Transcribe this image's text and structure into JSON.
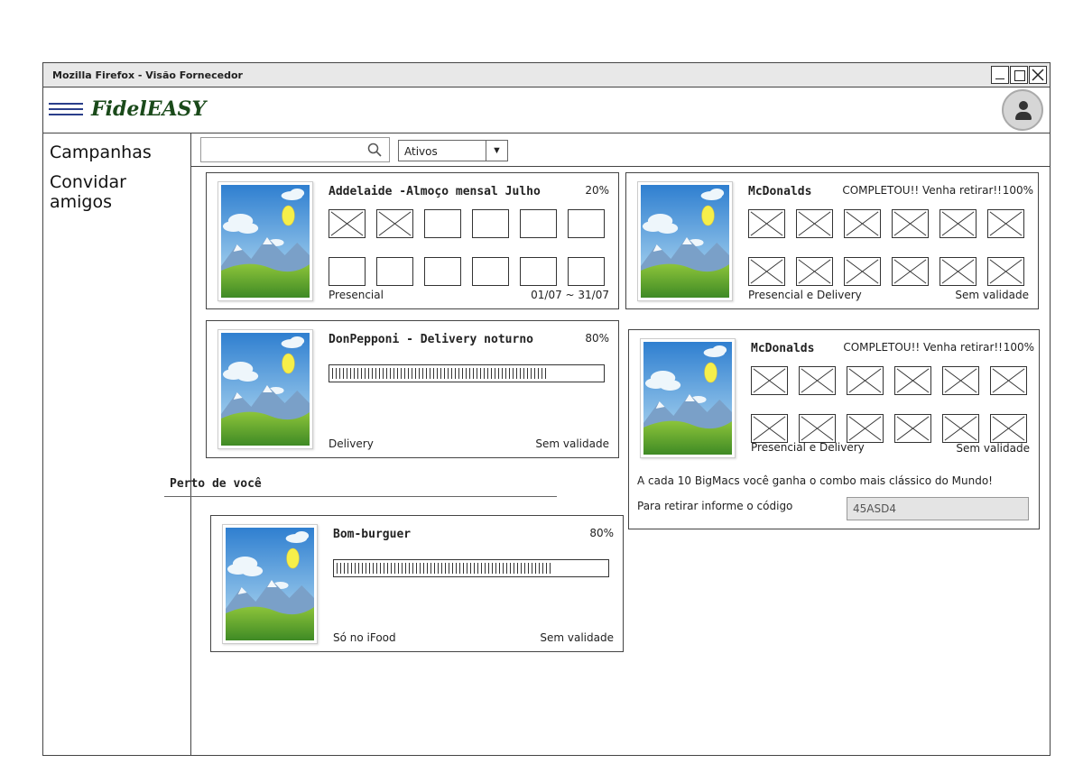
{
  "window": {
    "title": "Mozilla Firefox - Visão Fornecedor"
  },
  "app": {
    "brand": "FidelEASY"
  },
  "sidebar": {
    "items": [
      {
        "label": "Campanhas"
      },
      {
        "label": "Convidar amigos"
      }
    ]
  },
  "filter": {
    "search_value": "",
    "status_selected": "Ativos"
  },
  "cards": [
    {
      "title": "Addelaide -Almoço mensal Julho",
      "percent": "20%",
      "type": "stamps",
      "stamps_filled": 2,
      "stamps_total": 12,
      "mode": "Presencial",
      "validity": "01/07 ~ 31/07"
    },
    {
      "title": "McDonalds",
      "message": "COMPLETOU!! Venha retirar!!",
      "percent": "100%",
      "type": "stamps",
      "stamps_filled": 12,
      "stamps_total": 12,
      "mode": "Presencial e Delivery",
      "validity": "Sem validade"
    },
    {
      "title": "DonPepponi - Delivery noturno",
      "percent": "80%",
      "type": "progress",
      "progress": 0.8,
      "mode": "Delivery",
      "validity": "Sem validade"
    },
    {
      "title": "McDonalds",
      "message": "COMPLETOU!! Venha retirar!!",
      "percent": "100%",
      "type": "stamps",
      "stamps_filled": 12,
      "stamps_total": 12,
      "mode": "Presencial e Delivery",
      "validity": "Sem validade",
      "description": "A cada 10 BigMacs você ganha o combo mais clássico do Mundo!",
      "code_label": "Para retirar informe o código",
      "code": "45ASD4"
    }
  ],
  "nearby": {
    "title": "Perto de você",
    "cards": [
      {
        "title": "Bom-burguer",
        "percent": "80%",
        "type": "progress",
        "progress": 0.8,
        "mode": "Só no iFood",
        "validity": "Sem validade"
      }
    ]
  },
  "icons": {
    "menu": "hamburger-menu-icon",
    "avatar": "user-avatar-icon",
    "search": "search-icon",
    "dropdown": "caret-down-icon",
    "minimize": "minimize-icon",
    "maximize": "maximize-icon",
    "close": "close-icon"
  },
  "colors": {
    "brand": "#1a4a1a",
    "menu": "#2a3e8a"
  }
}
